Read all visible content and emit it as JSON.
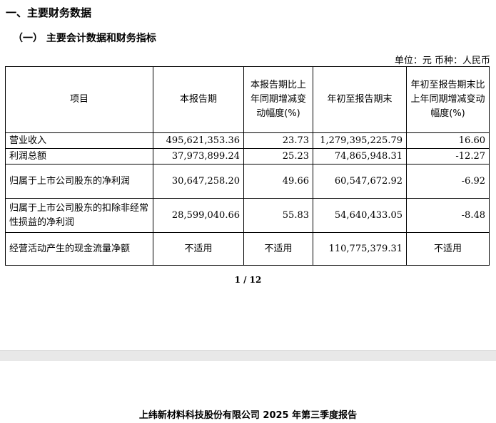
{
  "section_title": "一、主要财务数据",
  "subsection_title": "（一）  主要会计数据和财务指标",
  "unit_line": "单位：元   币种：人民币",
  "table": {
    "headers": [
      "项目",
      "本报告期",
      "本报告期比上年同期增减变动幅度(%)",
      "年初至报告期末",
      "年初至报告期末比上年同期增减变动幅度(%)"
    ],
    "rows": [
      {
        "item": "营业收入",
        "current": "495,621,353.36",
        "current_change": "23.73",
        "ytd": "1,279,395,225.79",
        "ytd_change": "16.60"
      },
      {
        "item": "利润总额",
        "current": "37,973,899.24",
        "current_change": "25.23",
        "ytd": "74,865,948.31",
        "ytd_change": "-12.27"
      },
      {
        "item": "归属于上市公司股东的净利润",
        "current": "30,647,258.20",
        "current_change": "49.66",
        "ytd": "60,547,672.92",
        "ytd_change": "-6.92"
      },
      {
        "item": "归属于上市公司股东的扣除非经常性损益的净利润",
        "current": "28,599,040.66",
        "current_change": "55.83",
        "ytd": "54,640,433.05",
        "ytd_change": "-8.48"
      },
      {
        "item": "经营活动产生的现金流量净额",
        "current": "不适用",
        "current_change": "不适用",
        "ytd": "110,775,379.31",
        "ytd_change": "不适用"
      }
    ]
  },
  "page_number": "1 / 12",
  "footer": "上纬新材料科技股份有限公司  2025 年第三季度报告"
}
